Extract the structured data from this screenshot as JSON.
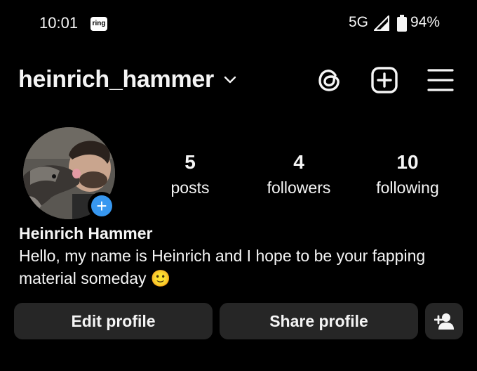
{
  "status_bar": {
    "time": "10:01",
    "ring_badge": "ring",
    "network": "5G",
    "battery": "94%"
  },
  "header": {
    "username": "heinrich_hammer"
  },
  "stats": {
    "posts_count": "5",
    "posts_label": "posts",
    "followers_count": "4",
    "followers_label": "followers",
    "following_count": "10",
    "following_label": "following"
  },
  "profile": {
    "full_name": "Heinrich Hammer",
    "bio": "Hello, my name is Heinrich and I hope to be your fapping material someday 🙂"
  },
  "buttons": {
    "edit_profile": "Edit profile",
    "share_profile": "Share profile"
  },
  "colors": {
    "background": "#000000",
    "button": "#262626",
    "accent": "#3797f0"
  }
}
